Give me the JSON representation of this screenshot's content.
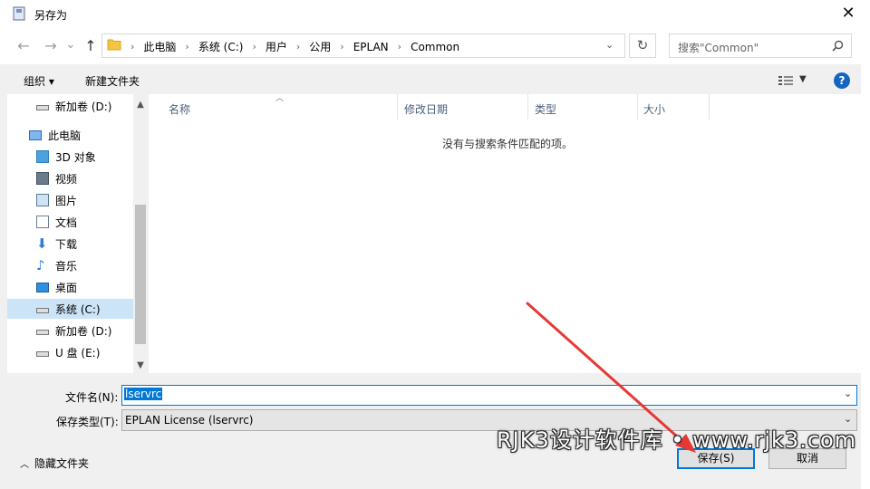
{
  "window": {
    "title": "另存为",
    "close_glyph": "✕"
  },
  "nav": {
    "back_glyph": "←",
    "forward_glyph": "→",
    "up_glyph": "↑",
    "recent_glyph": "⌄",
    "breadcrumbs": [
      "此电脑",
      "系统 (C:)",
      "用户",
      "公用",
      "EPLAN",
      "Common"
    ],
    "search_placeholder": "搜索\"Common\""
  },
  "toolbar": {
    "organize": "组织 ▾",
    "new_folder": "新建文件夹",
    "help": "?"
  },
  "sidebar": {
    "items": [
      {
        "label": "新加卷 (D:)",
        "icon": "drive-icon"
      },
      {
        "label": "此电脑",
        "icon": "computer-icon"
      },
      {
        "label": "3D 对象",
        "icon": "3d-objects-icon"
      },
      {
        "label": "视频",
        "icon": "video-icon"
      },
      {
        "label": "图片",
        "icon": "pictures-icon"
      },
      {
        "label": "文档",
        "icon": "documents-icon"
      },
      {
        "label": "下载",
        "icon": "download-icon"
      },
      {
        "label": "音乐",
        "icon": "music-icon"
      },
      {
        "label": "桌面",
        "icon": "desktop-icon"
      },
      {
        "label": "系统 (C:)",
        "icon": "system-drive-icon",
        "selected": true
      },
      {
        "label": "新加卷 (D:)",
        "icon": "drive-icon"
      },
      {
        "label": "U 盘 (E:)",
        "icon": "usb-drive-icon"
      }
    ]
  },
  "file_list": {
    "columns": [
      "名称",
      "修改日期",
      "类型",
      "大小"
    ],
    "empty_message": "没有与搜索条件匹配的项。"
  },
  "form": {
    "filename_label": "文件名(N):",
    "filename_value": "lservrc",
    "filetype_label": "保存类型(T):",
    "filetype_value": "EPLAN License (lservrc)"
  },
  "footer": {
    "hide_folders": "隐藏文件夹",
    "save": "保存(S)",
    "cancel": "取消"
  },
  "overlay": {
    "watermark": "RJK3设计软件库 • www.rjk3.com"
  },
  "colors": {
    "accent": "#0078d7",
    "selection": "#cce4f7",
    "annotation_arrow": "#e53935"
  }
}
